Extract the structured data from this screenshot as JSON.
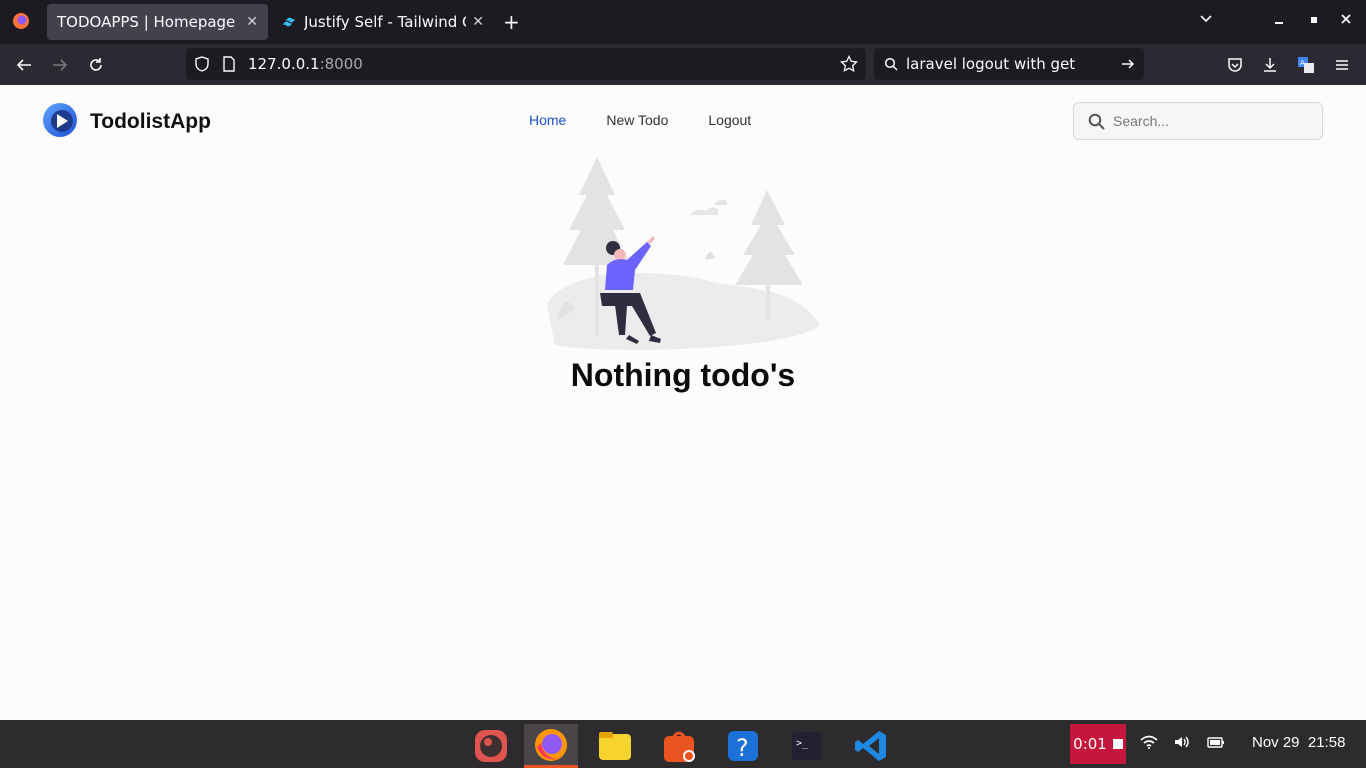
{
  "browser": {
    "tabs": [
      {
        "title": "TODOAPPS | Homepage",
        "active": true
      },
      {
        "title": "Justify Self - Tailwind C",
        "active": false
      }
    ],
    "url_host": "127.0.0.1",
    "url_port": ":8000",
    "search_query": "laravel logout with get"
  },
  "app": {
    "brand": "TodolistApp",
    "nav": {
      "home": "Home",
      "new_todo": "New Todo",
      "logout": "Logout"
    },
    "search_placeholder": "Search...",
    "empty_message": "Nothing todo's"
  },
  "taskbar": {
    "recording_time": "0:01",
    "date": "Nov 29",
    "time": "21:58"
  },
  "colors": {
    "accent_link": "#1d4ed8",
    "illustration_figure": "#6c63ff",
    "recorder": "#c7163b"
  }
}
